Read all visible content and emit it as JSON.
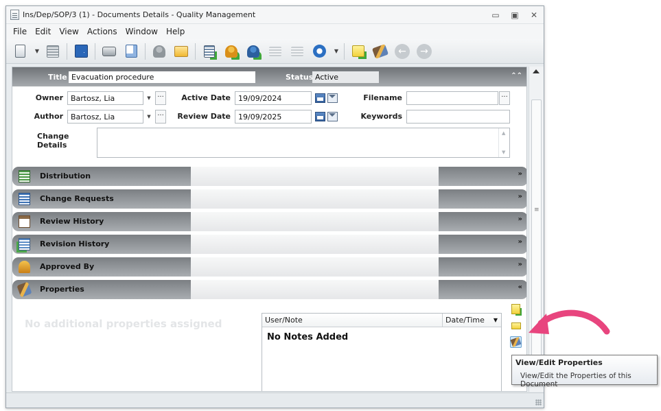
{
  "window": {
    "title": "Ins/Dep/SOP/3 (1) - Documents Details - Quality Management",
    "controls": [
      "minimize",
      "restore",
      "close"
    ]
  },
  "menu": [
    "File",
    "Edit",
    "View",
    "Actions",
    "Window",
    "Help"
  ],
  "toolbar": {
    "buttons": [
      "document-menu-icon",
      "list-view-icon",
      "save-icon",
      "print-icon",
      "print-preview-icon",
      "user-icon",
      "open-folder-icon",
      "add-list-icon",
      "add-user-icon",
      "assign-user-icon",
      "list-icon",
      "list-edit-icon",
      "refresh-icon",
      "add-note-icon",
      "properties-icon",
      "back-icon",
      "forward-icon"
    ]
  },
  "header": {
    "title_label": "Title",
    "title_value": "Evacuation procedure",
    "status_label": "Status",
    "status_value": "Active"
  },
  "form": {
    "owner_label": "Owner",
    "owner_value": "Bartosz, Lia",
    "author_label": "Author",
    "author_value": "Bartosz, Lia",
    "active_date_label": "Active Date",
    "active_date_value": "19/09/2024",
    "review_date_label": "Review Date",
    "review_date_value": "19/09/2025",
    "filename_label": "Filename",
    "filename_value": "",
    "keywords_label": "Keywords",
    "keywords_value": "",
    "change_details_label": "Change Details",
    "change_details_value": "",
    "more_button": "···"
  },
  "panels": [
    {
      "label": "Distribution",
      "icon": "distribution-icon",
      "chev": "»"
    },
    {
      "label": "Change Requests",
      "icon": "change-requests-icon",
      "chev": "»"
    },
    {
      "label": "Review History",
      "icon": "review-history-icon",
      "chev": "»"
    },
    {
      "label": "Revision History",
      "icon": "revision-history-icon",
      "chev": "»"
    },
    {
      "label": "Approved By",
      "icon": "approved-by-icon",
      "chev": "»"
    },
    {
      "label": "Properties",
      "icon": "properties-icon",
      "chev": "«"
    }
  ],
  "properties": {
    "empty_text": "No additional properties assigned",
    "notes_col_user": "User/Note",
    "notes_col_date": "Date/Time",
    "notes_empty": "No Notes Added"
  },
  "tooltip": {
    "title": "View/Edit Properties",
    "text": "View/Edit the Properties of this Document"
  },
  "colors": {
    "accent": "#e8457e",
    "header_dark": "#7b7f83"
  }
}
